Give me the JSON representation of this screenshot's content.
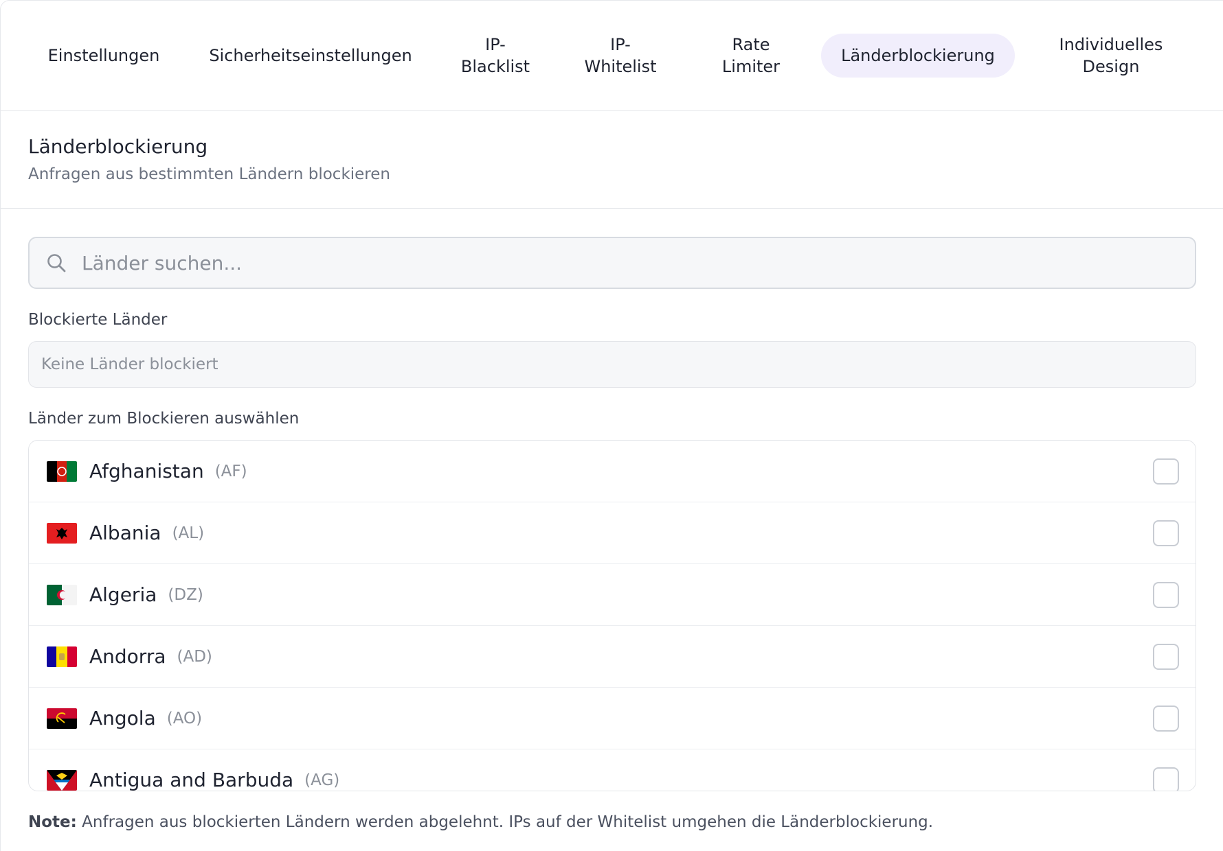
{
  "tabs": [
    {
      "label": "Einstellungen"
    },
    {
      "label": "Sicherheitseinstellungen"
    },
    {
      "label": "IP-\nBlacklist"
    },
    {
      "label": "IP-\nWhitelist"
    },
    {
      "label": "Rate\nLimiter"
    },
    {
      "label": "Länderblockierung",
      "active": true
    },
    {
      "label": "Individuelles\nDesign"
    }
  ],
  "section": {
    "title": "Länderblockierung",
    "subtitle": "Anfragen aus bestimmten Ländern blockieren"
  },
  "search": {
    "placeholder": "Länder suchen...",
    "value": "",
    "icon": "search-icon"
  },
  "blocked": {
    "label": "Blockierte Länder",
    "empty_text": "Keine Länder blockiert"
  },
  "select": {
    "label": "Länder zum Blockieren auswählen",
    "countries": [
      {
        "name": "Afghanistan",
        "code": "(AF)",
        "checked": false
      },
      {
        "name": "Albania",
        "code": "(AL)",
        "checked": false
      },
      {
        "name": "Algeria",
        "code": "(DZ)",
        "checked": false
      },
      {
        "name": "Andorra",
        "code": "(AD)",
        "checked": false
      },
      {
        "name": "Angola",
        "code": "(AO)",
        "checked": false
      },
      {
        "name": "Antigua and Barbuda",
        "code": "(AG)",
        "checked": false
      }
    ]
  },
  "note": {
    "bold": "Note:",
    "text": " Anfragen aus blockierten Ländern werden abgelehnt. IPs auf der Whitelist umgehen die Länderblockierung."
  },
  "colors": {
    "active_tab_bg": "#f1eefc",
    "border": "#e3e5e9",
    "muted_text": "#8b9099"
  }
}
